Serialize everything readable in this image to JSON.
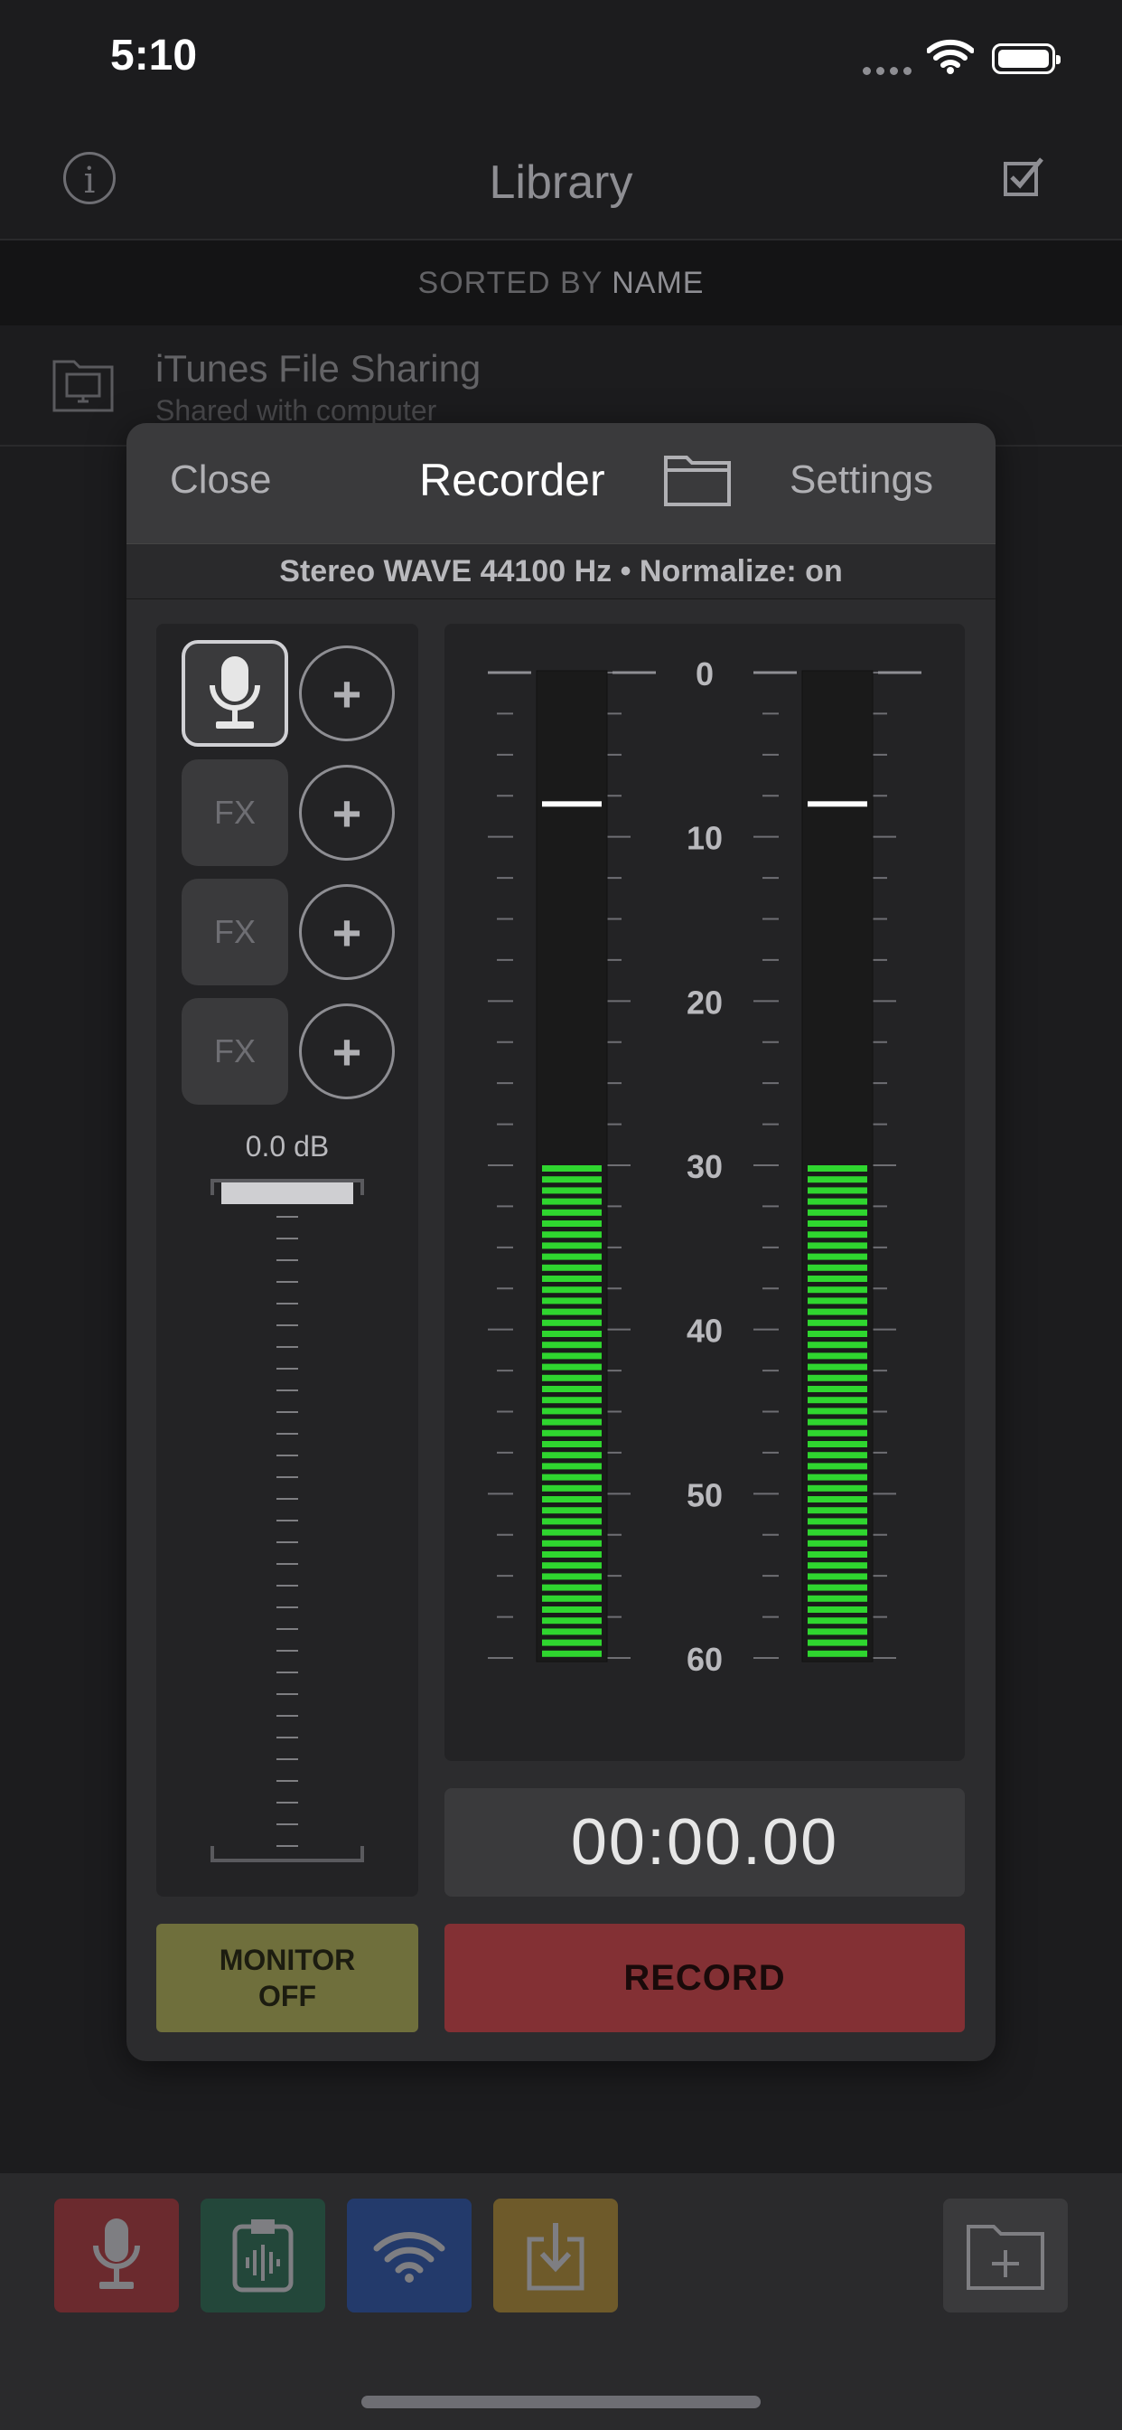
{
  "status_bar": {
    "time": "5:10"
  },
  "nav": {
    "title": "Library",
    "info_icon": "info-icon",
    "select_icon": "checkbox-icon"
  },
  "sort_bar": {
    "prefix": "SORTED BY ",
    "field": "NAME"
  },
  "library": {
    "items": [
      {
        "title": "iTunes File Sharing",
        "subtitle": "Shared with computer",
        "icon": "computer-folder-icon"
      }
    ]
  },
  "recorder": {
    "close_label": "Close",
    "title": "Recorder",
    "settings_label": "Settings",
    "format_info": "Stereo WAVE 44100 Hz • Normalize: on",
    "input": {
      "source_icon": "microphone-icon",
      "fx_slots": [
        "FX",
        "FX",
        "FX"
      ],
      "add_label": "+",
      "gain_label": "0.0 dB"
    },
    "meter": {
      "scale_labels": [
        "0",
        "10",
        "20",
        "30",
        "40",
        "50",
        "60"
      ],
      "left_channel": {
        "level_db": -30,
        "peak_db": -8
      },
      "right_channel": {
        "level_db": -30,
        "peak_db": -8
      },
      "active_color": "#2fd62f"
    },
    "timer": "00:00.00",
    "monitor_label": "MONITOR\nOFF",
    "record_label": "RECORD"
  },
  "toolbar": {
    "buttons": [
      {
        "name": "record-tool-button",
        "icon": "microphone-icon",
        "color": "#6b2a2e"
      },
      {
        "name": "clipboard-tool-button",
        "icon": "clipboard-audio-icon",
        "color": "#23473a"
      },
      {
        "name": "wifi-tool-button",
        "icon": "wifi-icon",
        "color": "#233a6b"
      },
      {
        "name": "import-tool-button",
        "icon": "download-icon",
        "color": "#6e5a2a"
      },
      {
        "name": "new-folder-button",
        "icon": "folder-plus-icon",
        "color": "#3a3a3c"
      }
    ]
  }
}
